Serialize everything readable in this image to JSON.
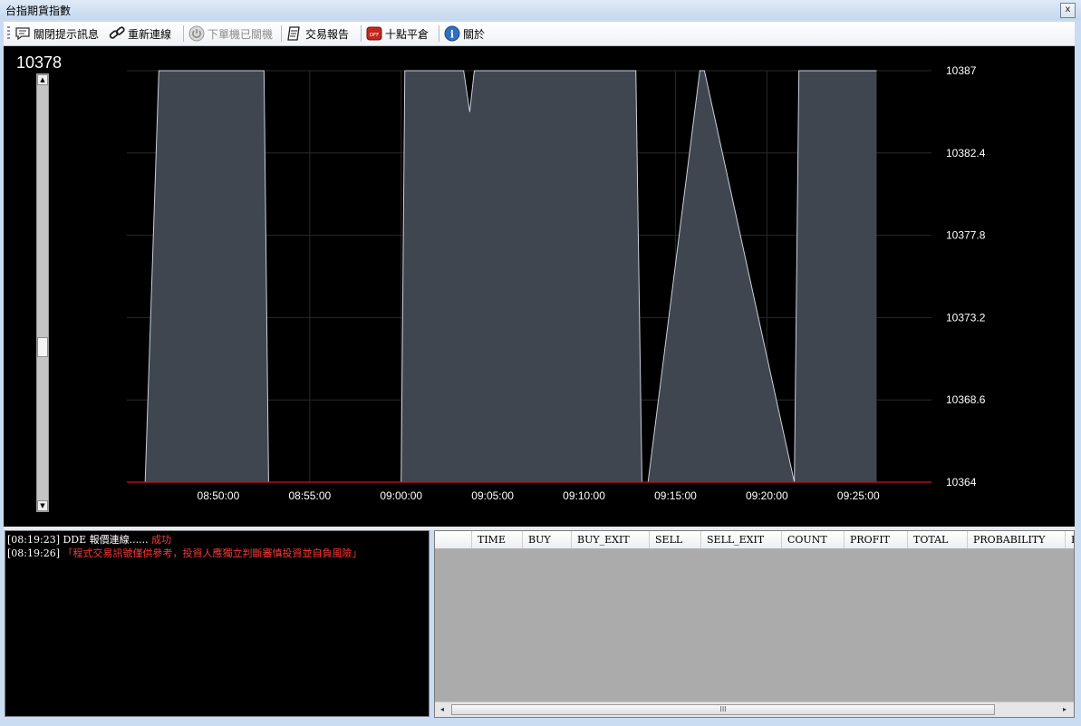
{
  "window": {
    "title": "台指期貨指數",
    "close_label": "x"
  },
  "toolbar": {
    "buttons": [
      {
        "label": "關閉提示訊息",
        "icon": "speech-bubble-icon"
      },
      {
        "label": "重新連線",
        "icon": "link-icon"
      },
      {
        "label": "下單機已關機",
        "icon": "power-icon"
      },
      {
        "label": "交易報告",
        "icon": "report-icon"
      },
      {
        "label": "十點平倉",
        "icon": "off-switch-icon",
        "badge": "OFF"
      },
      {
        "label": "關於",
        "icon": "info-icon",
        "badge": "i"
      }
    ]
  },
  "chart": {
    "current_price": "10378",
    "y_ticks": [
      "10387",
      "10382.4",
      "10377.8",
      "10373.2",
      "10368.6",
      "10364"
    ],
    "x_ticks": [
      "08:50:00",
      "08:55:00",
      "09:00:00",
      "09:05:00",
      "09:10:00",
      "09:15:00",
      "09:20:00",
      "09:25:00"
    ]
  },
  "chart_data": {
    "type": "area",
    "ylim": [
      10364,
      10387
    ],
    "xlabel": "",
    "ylabel": "",
    "grid": true,
    "x": [
      "08:46:00",
      "08:46:45",
      "08:52:30",
      "08:52:45",
      "09:00:00",
      "09:00:12",
      "09:03:25",
      "09:03:45",
      "09:04:00",
      "09:07:00",
      "09:12:50",
      "09:13:10",
      "09:13:30",
      "09:16:20",
      "09:16:35",
      "09:21:30",
      "09:21:45",
      "09:26:00"
    ],
    "y": [
      10364,
      10387,
      10387,
      10364,
      10364,
      10387,
      10387,
      10384.7,
      10387,
      10387,
      10387,
      10364,
      10364,
      10387,
      10387,
      10364,
      10387,
      10387
    ],
    "colors": {
      "area_fill": "#3f4650",
      "line": "#c9d0da",
      "baseline": "#d11212",
      "grid": "#2a2a2a"
    }
  },
  "log": {
    "lines": [
      {
        "prefix": "[08:19:23] DDE 報價連線......",
        "highlight": " 成功"
      },
      {
        "prefix": "[08:19:26]",
        "highlight": " 「程式交易訊號僅供參考，投資人應獨立判斷審慎投資並自負風險」"
      }
    ]
  },
  "grid": {
    "columns": [
      "",
      "TIME",
      "BUY",
      "BUY_EXIT",
      "SELL",
      "SELL_EXIT",
      "COUNT",
      "PROFIT",
      "TOTAL",
      "PROBABILITY",
      "E"
    ],
    "scroll_thumb_label": "III"
  }
}
